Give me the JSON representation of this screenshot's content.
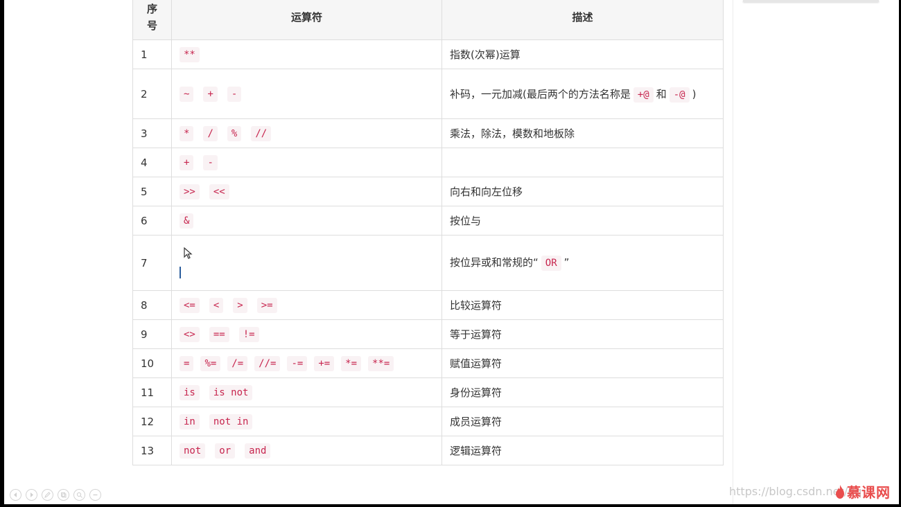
{
  "table": {
    "header": {
      "index": [
        "序",
        "号"
      ],
      "operator": "运算符",
      "description": "描述"
    },
    "rows": [
      {
        "index": "1",
        "ops": [
          "**"
        ],
        "desc": "指数(次幂)运算"
      },
      {
        "index": "2",
        "ops": [
          "~",
          "+",
          "-"
        ],
        "desc_pre": "补码，一元加减(最后两个的方法名称是",
        "desc_code1": "+@",
        "desc_mid": "和",
        "desc_code2": "-@",
        "desc_post": ")"
      },
      {
        "index": "3",
        "ops": [
          "*",
          "/",
          "%",
          "//"
        ],
        "desc": "乘法，除法，模数和地板除"
      },
      {
        "index": "4",
        "ops": [
          "+",
          "-"
        ],
        "desc": ""
      },
      {
        "index": "5",
        "ops": [
          ">>",
          "<<"
        ],
        "desc": "向右和向左位移"
      },
      {
        "index": "6",
        "ops": [
          "&"
        ],
        "desc": "按位与"
      },
      {
        "index": "7",
        "ops": [],
        "desc_pre": "按位异或和常规的“",
        "desc_code": "OR",
        "desc_post": "”"
      },
      {
        "index": "8",
        "ops": [
          "<=",
          "<",
          ">",
          ">="
        ],
        "desc": "比较运算符"
      },
      {
        "index": "9",
        "ops": [
          "<>",
          "==",
          "!="
        ],
        "desc": "等于运算符"
      },
      {
        "index": "10",
        "ops": [
          "=",
          "%=",
          "/=",
          "//=",
          "-=",
          "+=",
          "*=",
          "**="
        ],
        "desc": "赋值运算符"
      },
      {
        "index": "11",
        "ops": [
          "is",
          "is not"
        ],
        "desc": "身份运算符"
      },
      {
        "index": "12",
        "ops": [
          "in",
          "not in"
        ],
        "desc": "成员运算符"
      },
      {
        "index": "13",
        "ops": [
          "not",
          "or",
          "and"
        ],
        "desc": "逻辑运算符"
      }
    ]
  },
  "watermark": "https://blog.csdn.net/qq",
  "logo_text": "慕课网",
  "player_controls": [
    "prev-icon",
    "play-icon",
    "pen-icon",
    "copy-icon",
    "zoom-icon",
    "more-icon"
  ],
  "colors": {
    "code_fg": "#c7254e",
    "code_bg": "#f9f2f4",
    "border": "#dddddd",
    "header_bg": "#f6f6f6",
    "logo": "#e94d4d"
  }
}
